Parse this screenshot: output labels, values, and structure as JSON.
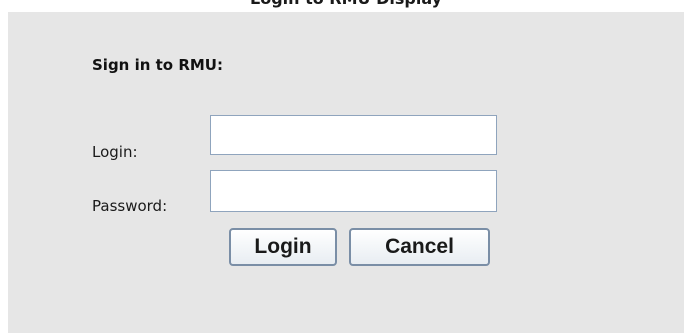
{
  "header": {
    "partial_text": "Login to RMU Display"
  },
  "form": {
    "title": "Sign in to RMU:",
    "login_label": "Login:",
    "login_value": "",
    "password_label": "Password:",
    "password_value": "",
    "login_button": "Login",
    "cancel_button": "Cancel"
  },
  "colors": {
    "panel_background": "#e6e6e6",
    "field_border": "#8fa4bd",
    "button_border": "#7a8ea6"
  }
}
